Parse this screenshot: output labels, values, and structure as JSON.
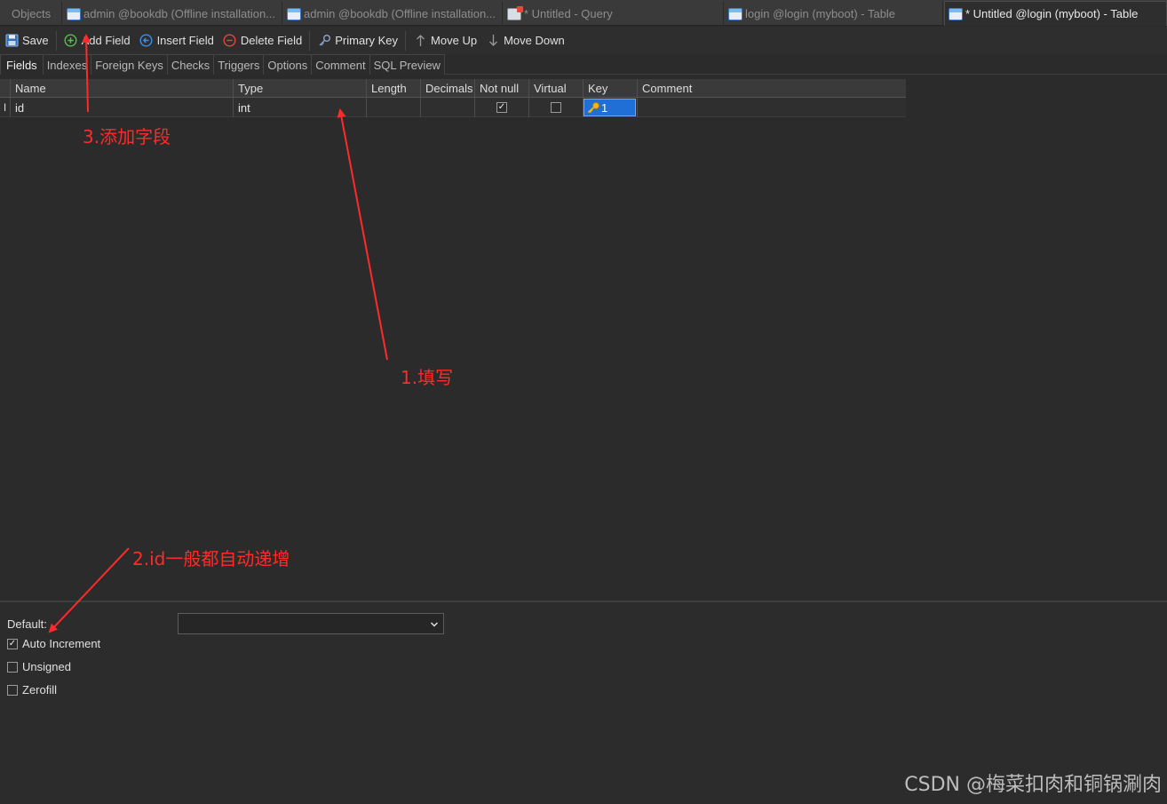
{
  "window_tabs": [
    {
      "label": "Objects",
      "icon": "none",
      "active": false
    },
    {
      "label": "admin @bookdb (Offline installation...",
      "icon": "table-icon",
      "active": false
    },
    {
      "label": "admin @bookdb (Offline installation...",
      "icon": "table-icon",
      "active": false
    },
    {
      "label": "* Untitled - Query",
      "icon": "query-icon",
      "active": false
    },
    {
      "label": "login @login (myboot) - Table",
      "icon": "table-icon",
      "active": false
    },
    {
      "label": "* Untitled @login (myboot) - Table",
      "icon": "table-edit-icon",
      "active": true
    }
  ],
  "toolbar": {
    "save": "Save",
    "add_field": "Add Field",
    "insert_field": "Insert Field",
    "delete_field": "Delete Field",
    "primary_key": "Primary Key",
    "move_up": "Move Up",
    "move_down": "Move Down"
  },
  "sub_tabs": [
    "Fields",
    "Indexes",
    "Foreign Keys",
    "Checks",
    "Triggers",
    "Options",
    "Comment",
    "SQL Preview"
  ],
  "grid": {
    "columns": [
      "Name",
      "Type",
      "Length",
      "Decimals",
      "Not null",
      "Virtual",
      "Key",
      "Comment"
    ],
    "rows": [
      {
        "marker": "I",
        "name": "id",
        "type": "int",
        "length": "",
        "decimals": "",
        "not_null": true,
        "virtual": false,
        "key": "1",
        "comment": ""
      }
    ]
  },
  "properties": {
    "default_label": "Default:",
    "default_value": "",
    "auto_increment_label": "Auto Increment",
    "auto_increment": true,
    "unsigned_label": "Unsigned",
    "unsigned": false,
    "zerofill_label": "Zerofill",
    "zerofill": false
  },
  "annotations": {
    "note_1": "1.填写",
    "note_2": "2.id一般都自动递增",
    "note_3": "3.添加字段",
    "color": "#ff2a2a"
  },
  "watermark": "CSDN @梅菜扣肉和铜锅涮肉"
}
